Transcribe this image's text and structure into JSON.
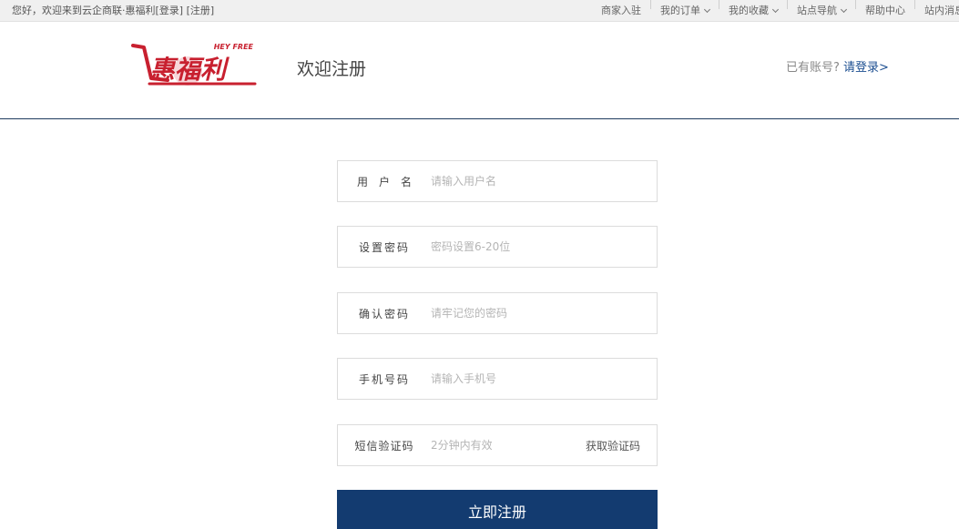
{
  "topbar": {
    "welcome_prefix": "您好，欢迎来到云企商联·惠福利",
    "login_link": "[登录]",
    "register_link": "[注册]",
    "links": [
      "商家入驻",
      "我的订单",
      "我的收藏",
      "站点导航",
      "帮助中心",
      "站内消息"
    ]
  },
  "header": {
    "logo_text": "惠福利",
    "logo_tag": "HEY FREE",
    "title": "欢迎注册",
    "has_account": "已有账号?",
    "login_prompt": "请登录>"
  },
  "form": {
    "username": {
      "label": "用户名",
      "placeholder": "请输入用户名"
    },
    "password": {
      "label": "设置密码",
      "placeholder": "密码设置6-20位"
    },
    "confirm": {
      "label": "确认密码",
      "placeholder": "请牢记您的密码"
    },
    "phone": {
      "label": "手机号码",
      "placeholder": "请输入手机号"
    },
    "sms": {
      "label": "短信验证码",
      "placeholder": "2分钟内有效",
      "get_code": "获取验证码"
    },
    "submit_label": "立即注册"
  },
  "colors": {
    "primary": "#133b70",
    "logo_red": "#c8202f",
    "link_blue": "#1d4f91"
  }
}
